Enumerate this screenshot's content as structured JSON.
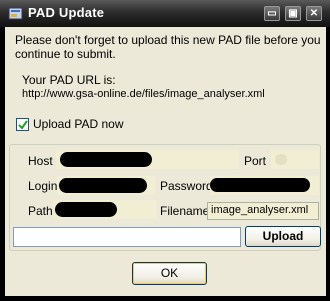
{
  "window": {
    "title": "PAD Update",
    "minimize_glyph": "▭",
    "maximize_glyph": "▣",
    "close_glyph": "✕"
  },
  "message": {
    "line1": "Please don't forget to upload this new PAD file before you",
    "line2": "continue to submit."
  },
  "pad_url": {
    "label": "Your PAD URL is:",
    "value": "http://www.gsa-online.de/files/image_analyser.xml"
  },
  "upload_checkbox": {
    "label": "Upload PAD now",
    "checked": true
  },
  "form": {
    "host_label": "Host",
    "port_label": "Port",
    "login_label": "Login",
    "password_label": "Password",
    "path_label": "Path",
    "filename_label": "Filename",
    "filename_value": "image_analyser.xml"
  },
  "buttons": {
    "upload": "Upload",
    "ok": "OK"
  },
  "colors": {
    "titlebar": "#2c2c2c",
    "dialog_bg": "#ece9d8",
    "field_bg": "#f2eed4",
    "button_border": "#003c74"
  }
}
